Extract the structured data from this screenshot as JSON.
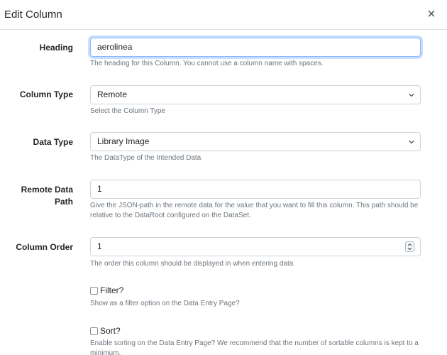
{
  "modal": {
    "title": "Edit Column",
    "close_symbol": "×"
  },
  "fields": {
    "heading": {
      "label": "Heading",
      "value": "aerolinea",
      "help": "The heading for this Column. You cannot use a column name with spaces."
    },
    "column_type": {
      "label": "Column Type",
      "selected": "Remote",
      "help": "Select the Column Type"
    },
    "data_type": {
      "label": "Data Type",
      "selected": "Library Image",
      "help": "The DataType of the Intended Data"
    },
    "remote_data_path": {
      "label_line1": "Remote Data",
      "label_line2": "Path",
      "value": "1",
      "help_line1": "Give the JSON-path in the remote data for the value that you want to fill this column. This path should be",
      "help_line2": "relative to the DataRoot configured on the DataSet."
    },
    "column_order": {
      "label": "Column Order",
      "value": "1",
      "help": "The order this column should be displayed in when entering data"
    },
    "filter": {
      "label": "Filter?",
      "checked": false,
      "help": "Show as a filter option on the Data Entry Page?"
    },
    "sort": {
      "label": "Sort?",
      "checked": false,
      "help_line1": "Enable sorting on the Data Entry Page? We recommend that the number of sortable columns is kept to a",
      "help_line2": "minimum."
    }
  },
  "colors": {
    "focus_border": "#86b7fe",
    "help_text": "#6c757d",
    "border": "#ced4da"
  }
}
